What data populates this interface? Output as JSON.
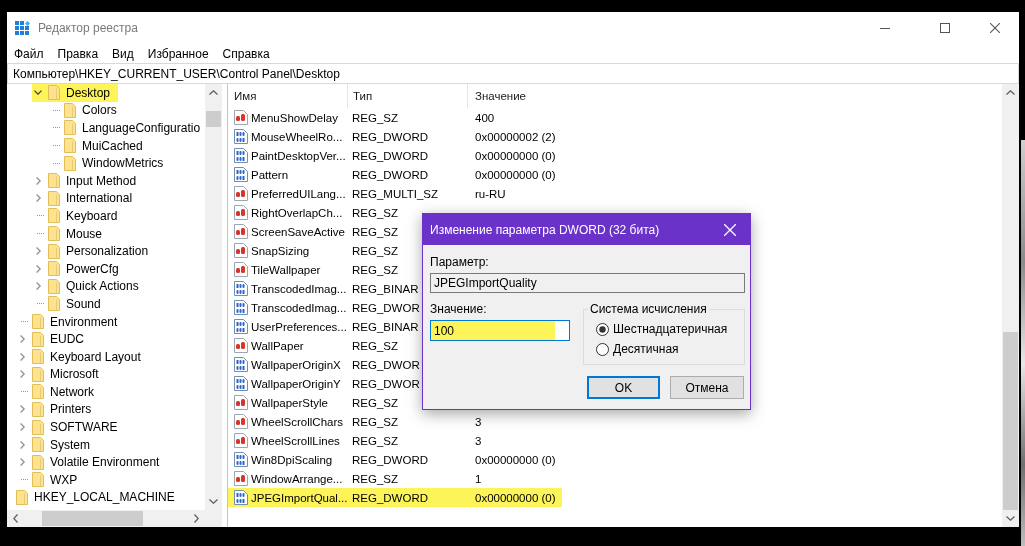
{
  "window": {
    "title": "Редактор реестра"
  },
  "menu": [
    "Файл",
    "Правка",
    "Вид",
    "Избранное",
    "Справка"
  ],
  "address": "Компьютер\\HKEY_CURRENT_USER\\Control Panel\\Desktop",
  "tree": {
    "items": [
      {
        "children": [
          {
            "children": [
              {
                "label": "Desktop",
                "expanded": true,
                "highlighted": true,
                "children": [
                  {
                    "label": "Colors",
                    "leaf": true,
                    "highlighted": false
                  },
                  {
                    "label": "LanguageConfiguratio",
                    "leaf": true,
                    "highlighted": false
                  },
                  {
                    "label": "MuiCached",
                    "leaf": true,
                    "highlighted": false
                  },
                  {
                    "label": "WindowMetrics",
                    "leaf": true,
                    "highlighted": false
                  }
                ]
              },
              {
                "label": "Input Method",
                "expanded": false,
                "highlighted": false
              },
              {
                "label": "International",
                "expanded": false,
                "highlighted": false
              },
              {
                "label": "Keyboard",
                "leaf": true,
                "highlighted": false
              },
              {
                "label": "Mouse",
                "leaf": true,
                "highlighted": false
              },
              {
                "label": "Personalization",
                "expanded": false,
                "highlighted": false
              },
              {
                "label": "PowerCfg",
                "expanded": false,
                "highlighted": false
              },
              {
                "label": "Quick Actions",
                "expanded": false,
                "highlighted": false
              },
              {
                "label": "Sound",
                "leaf": true,
                "highlighted": false
              }
            ]
          },
          {
            "label": "Environment",
            "leaf": true,
            "highlighted": false
          },
          {
            "label": "EUDC",
            "expanded": false,
            "highlighted": false
          },
          {
            "label": "Keyboard Layout",
            "expanded": false,
            "highlighted": false
          },
          {
            "label": "Microsoft",
            "expanded": false,
            "highlighted": false
          },
          {
            "label": "Network",
            "leaf": true,
            "highlighted": false
          },
          {
            "label": "Printers",
            "expanded": false,
            "highlighted": false
          },
          {
            "label": "SOFTWARE",
            "expanded": false,
            "highlighted": false
          },
          {
            "label": "System",
            "expanded": false,
            "highlighted": false
          },
          {
            "label": "Volatile Environment",
            "expanded": false,
            "highlighted": false
          },
          {
            "label": "WXP",
            "leaf": true,
            "highlighted": false
          }
        ]
      },
      {
        "label": "HKEY_LOCAL_MACHINE",
        "highlighted": false
      }
    ]
  },
  "list": {
    "columns": [
      "Имя",
      "Тип",
      "Значение"
    ],
    "rows": [
      {
        "kind": "string",
        "name": "MenuShowDelay",
        "type": "REG_SZ",
        "value": "400",
        "highlighted": false
      },
      {
        "kind": "binary",
        "name": "MouseWheelRo...",
        "type": "REG_DWORD",
        "value": "0x00000002 (2)",
        "highlighted": false
      },
      {
        "kind": "binary",
        "name": "PaintDesktopVer...",
        "type": "REG_DWORD",
        "value": "0x00000000 (0)",
        "highlighted": false
      },
      {
        "kind": "binary",
        "name": "Pattern",
        "type": "REG_DWORD",
        "value": "0x00000000 (0)",
        "highlighted": false
      },
      {
        "kind": "string",
        "name": "PreferredUILang...",
        "type": "REG_MULTI_SZ",
        "value": "ru-RU",
        "highlighted": false
      },
      {
        "kind": "string",
        "name": "RightOverlapCh...",
        "type": "REG_SZ",
        "highlighted": false
      },
      {
        "kind": "string",
        "name": "ScreenSaveActive",
        "type": "REG_SZ",
        "highlighted": false
      },
      {
        "kind": "string",
        "name": "SnapSizing",
        "type": "REG_SZ",
        "highlighted": false
      },
      {
        "kind": "string",
        "name": "TileWallpaper",
        "type": "REG_SZ",
        "highlighted": false
      },
      {
        "kind": "binary",
        "name": "TranscodedImag...",
        "type": "REG_BINAR",
        "highlighted": false
      },
      {
        "kind": "binary",
        "name": "TranscodedImag...",
        "type": "REG_DWOR",
        "highlighted": false
      },
      {
        "kind": "binary",
        "name": "UserPreferences...",
        "type": "REG_BINAR",
        "highlighted": false
      },
      {
        "kind": "string",
        "name": "WallPaper",
        "type": "REG_SZ",
        "highlighted": false
      },
      {
        "kind": "binary",
        "name": "WallpaperOriginX",
        "type": "REG_DWOR",
        "highlighted": false
      },
      {
        "kind": "binary",
        "name": "WallpaperOriginY",
        "type": "REG_DWOR",
        "highlighted": false
      },
      {
        "kind": "string",
        "name": "WallpaperStyle",
        "type": "REG_SZ",
        "highlighted": false
      },
      {
        "kind": "string",
        "name": "WheelScrollChars",
        "type": "REG_SZ",
        "value": "3",
        "highlighted": false
      },
      {
        "kind": "string",
        "name": "WheelScrollLines",
        "type": "REG_SZ",
        "value": "3",
        "highlighted": false
      },
      {
        "kind": "binary",
        "name": "Win8DpiScaling",
        "type": "REG_DWORD",
        "value": "0x00000000 (0)",
        "highlighted": false
      },
      {
        "kind": "string",
        "name": "WindowArrange...",
        "type": "REG_SZ",
        "value": "1",
        "highlighted": false
      },
      {
        "kind": "binary",
        "name": "JPEGImportQual...",
        "type": "REG_DWORD",
        "value": "0x00000000 (0)",
        "highlighted": true
      }
    ]
  },
  "dialog": {
    "title": "Изменение параметра DWORD (32 бита)",
    "name_label": "Параметр:",
    "name_value": "JPEGImportQuality",
    "value_label": "Значение:",
    "value": "100",
    "value_highlighted": true,
    "number_base": {
      "label": "Система исчисления",
      "options": [
        {
          "label": "Шестнадцатеричная",
          "selected": true
        },
        {
          "label": "Десятичная",
          "selected": false
        }
      ]
    },
    "buttons": [
      {
        "label": "OK",
        "default": true
      },
      {
        "label": "Отмена",
        "default": false
      }
    ]
  }
}
